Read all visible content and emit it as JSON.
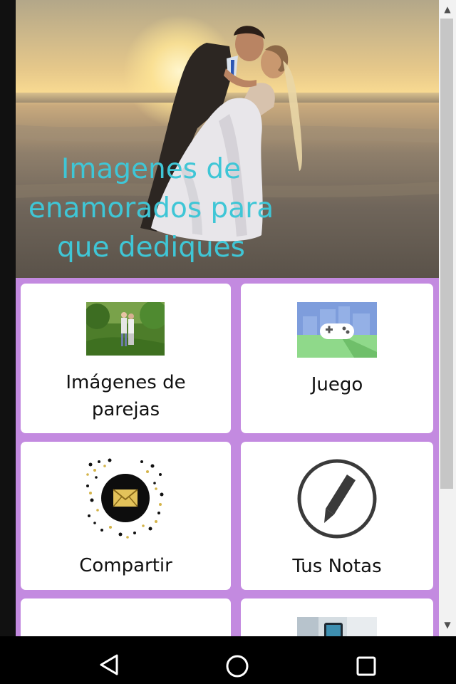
{
  "hero": {
    "title_lines": [
      "Imagenes de",
      "enamorados para",
      "que dediques"
    ]
  },
  "cards": [
    {
      "label_line1": "Imágenes de",
      "label_line2": "parejas"
    },
    {
      "label": "Juego"
    },
    {
      "label": "Compartir"
    },
    {
      "label": "Tus Notas"
    }
  ],
  "icons": {
    "couple_thumb": "couple-photo-icon",
    "game": "gamepad-icon",
    "share": "envelope-confetti-icon",
    "notes": "pencil-circle-icon",
    "phone_thumb": "phone-photo-icon"
  },
  "colors": {
    "background": "#c38ae0",
    "hero_title": "#3fc6d6",
    "card": "#ffffff"
  },
  "navigation": {
    "back": "back-triangle-icon",
    "home": "home-circle-icon",
    "recents": "recents-square-icon"
  }
}
